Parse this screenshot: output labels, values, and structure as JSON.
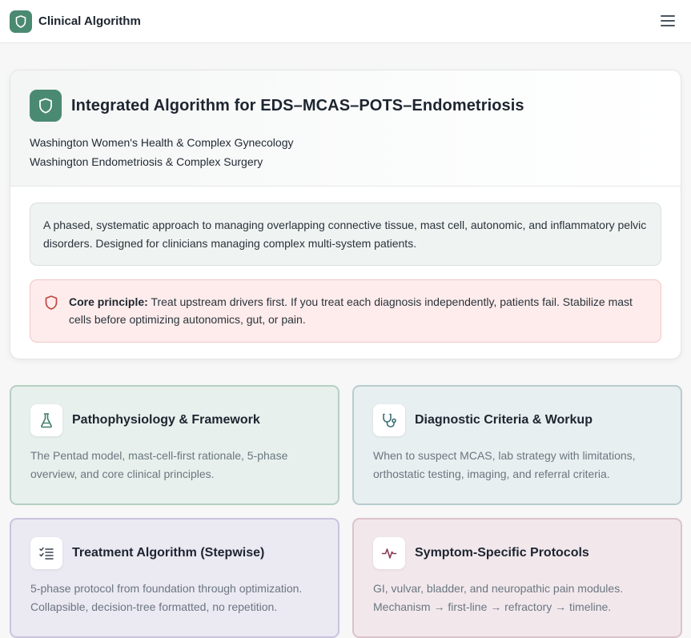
{
  "app": {
    "title": "Clinical Algorithm",
    "icons": {
      "brand": "shield-icon",
      "menu": "menu-icon"
    },
    "accent_color": "#4b8a72"
  },
  "hero": {
    "title": "Integrated Algorithm for EDS–MCAS–POTS–Endometriosis",
    "subtitle_line1": "Washington Women's Health & Complex Gynecology",
    "subtitle_line2": "Washington Endometriosis & Complex Surgery",
    "intro": "A phased, systematic approach to managing overlapping connective tissue, mast cell, autonomic, and inflammatory pelvic disorders. Designed for clinicians managing complex multi-system patients.",
    "principle_label": "Core principle:",
    "principle_text": " Treat upstream drivers first. If you treat each diagnosis independently, patients fail. Stabilize mast cells before optimizing autonomics, gut, or pain."
  },
  "cards": [
    {
      "title": "Pathophysiology & Framework",
      "description": "The Pentad model, mast-cell-first rationale, 5-phase overview, and core clinical principles.",
      "icon": "flask-icon"
    },
    {
      "title": "Diagnostic Criteria & Workup",
      "description": "When to suspect MCAS, lab strategy with limitations, orthostatic testing, imaging, and referral criteria.",
      "icon": "stethoscope-icon"
    },
    {
      "title": "Treatment Algorithm (Stepwise)",
      "description": "5-phase protocol from foundation through optimization. Collapsible, decision-tree formatted, no repetition.",
      "icon": "checklist-icon"
    },
    {
      "title": "Symptom-Specific Protocols",
      "description": "GI, vulvar, bladder, and neuropathic pain modules. Mechanism → first-line → refractory → timeline.",
      "icon": "pulse-icon"
    }
  ]
}
